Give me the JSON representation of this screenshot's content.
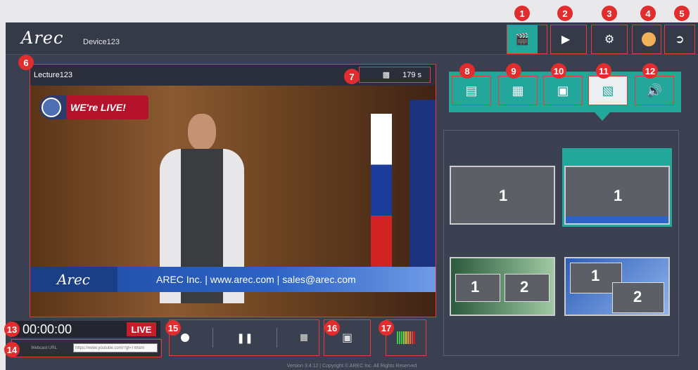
{
  "header": {
    "logo": "Arec",
    "device_name": "Device123",
    "buttons": [
      {
        "id": "1",
        "icon": "clapperboard-icon"
      },
      {
        "id": "2",
        "icon": "video-camera-icon"
      },
      {
        "id": "3",
        "icon": "gears-icon"
      },
      {
        "id": "4",
        "icon": "media-icon"
      },
      {
        "id": "5",
        "icon": "logout-icon"
      }
    ]
  },
  "video": {
    "badge": "6",
    "title": "Lecture123",
    "timer_badge": "7",
    "timer_value": "179 s",
    "live_banner": "WE're LIVE!",
    "lower_logo": "Arec",
    "lower_text": "AREC Inc. |   www.arec.com  |  sales@arec.com"
  },
  "modes": {
    "items": [
      {
        "id": "8",
        "icon": "stripes-icon"
      },
      {
        "id": "9",
        "icon": "layout-icon"
      },
      {
        "id": "10",
        "icon": "image-add-icon"
      },
      {
        "id": "11",
        "icon": "overlay-icon"
      },
      {
        "id": "12",
        "icon": "speaker-icon"
      }
    ],
    "selected": "11"
  },
  "layouts": {
    "items": [
      {
        "label_1": "1"
      },
      {
        "label_1": "1"
      },
      {
        "label_1": "1",
        "label_2": "2"
      },
      {
        "label_1": "1",
        "label_2": "2"
      }
    ]
  },
  "status": {
    "badge": "13",
    "time": "00:00:00",
    "live": "LIVE"
  },
  "webcast": {
    "badge": "14",
    "label": "Webcast URL",
    "value": "https://www.youtube.com/?gl=TW&hl"
  },
  "controls": {
    "rec_badge": "15",
    "snapshot_badge": "16",
    "meter_badge": "17"
  },
  "footer": {
    "text": "Version 3.4.12 | Copyright © AREC Inc. All Rights Reserved"
  }
}
